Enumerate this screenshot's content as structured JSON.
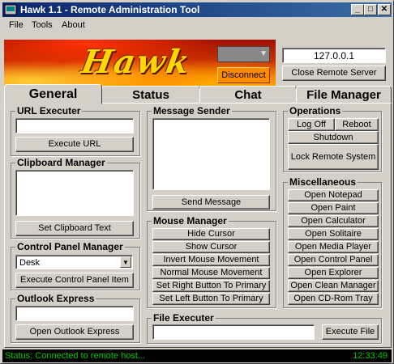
{
  "window": {
    "title": "Hawk 1.1 - Remote Administration Tool"
  },
  "menu": [
    "File",
    "Tools",
    "About"
  ],
  "banner": {
    "logo_text": "Hawk",
    "disconnect_label": "Disconnect"
  },
  "connection": {
    "ip": "127.0.0.1",
    "close_server_label": "Close Remote Server"
  },
  "tabs": [
    "General",
    "Status",
    "Chat",
    "File Manager"
  ],
  "url_executer": {
    "title": "URL Executer",
    "url_value": "",
    "button": "Execute URL"
  },
  "clipboard": {
    "title": "Clipboard Manager",
    "button": "Set Clipboard Text"
  },
  "control_panel": {
    "title": "Control Panel Manager",
    "selected": "Desk",
    "button": "Execute Control Panel Item"
  },
  "outlook": {
    "title": "Outlook Express",
    "button": "Open Outlook Express"
  },
  "message_sender": {
    "title": "Message Sender",
    "button": "Send Message"
  },
  "mouse_manager": {
    "title": "Mouse Manager",
    "buttons": [
      "Hide Cursor",
      "Show Cursor",
      "Invert Mouse Movement",
      "Normal Mouse Movement",
      "Set Right Button To Primary",
      "Set Left Button To Primary"
    ]
  },
  "file_executer": {
    "title": "File Executer",
    "button": "Execute File"
  },
  "operations": {
    "title": "Operations",
    "logoff": "Log Off",
    "reboot": "Reboot",
    "shutdown": "Shutdown",
    "lock": "Lock Remote System"
  },
  "misc": {
    "title": "Miscellaneous",
    "buttons": [
      "Open Notepad",
      "Open Paint",
      "Open Calculator",
      "Open Solitaire",
      "Open Media Player",
      "Open Control Panel",
      "Open Explorer",
      "Open Clean Manager",
      "Open CD-Rom Tray"
    ]
  },
  "status": {
    "text": "Status: Connected to remote host...",
    "time": "12:33:49"
  },
  "colors": {
    "title_start": "#0a246a",
    "title_end": "#3a6ea5",
    "status_text": "#00c800",
    "disconnect": "#ff8c00"
  }
}
